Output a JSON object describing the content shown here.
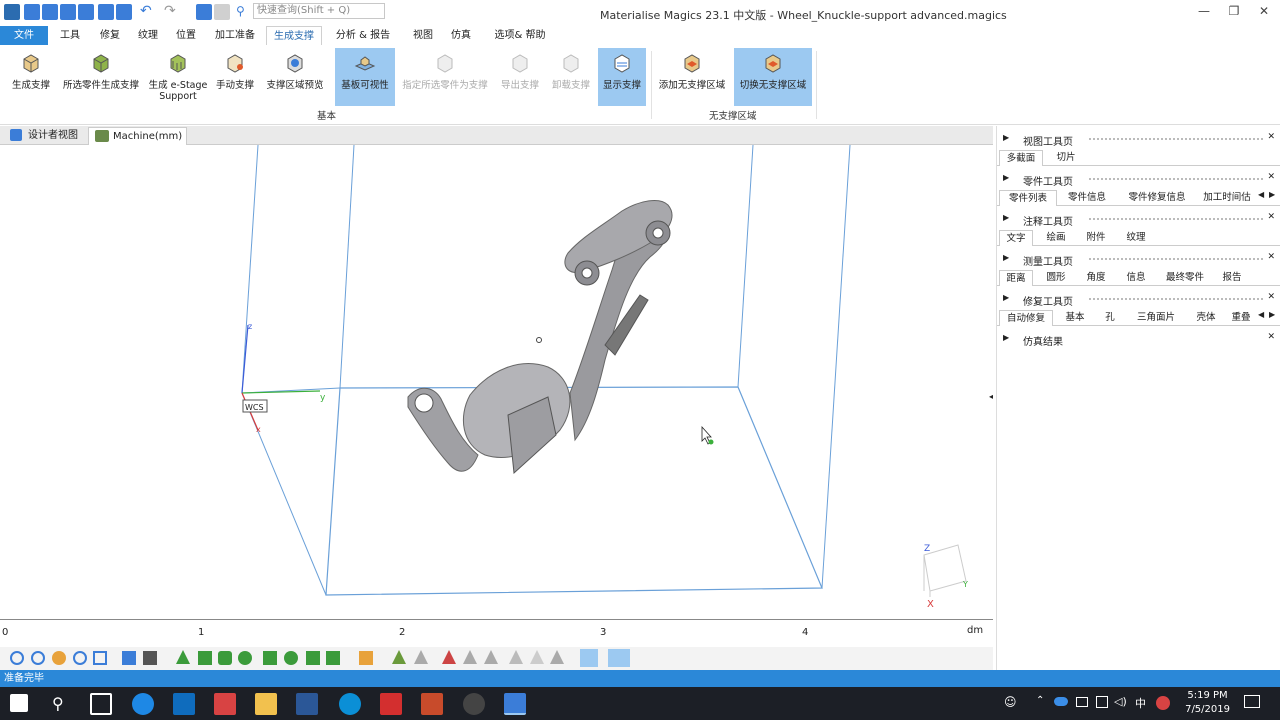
{
  "app": {
    "title": "Materialise Magics 23.1 中文版 - Wheel_Knuckle-support advanced.magics",
    "search_placeholder": "快速查询(Shift + Q)",
    "accent": "#2b88d8"
  },
  "menu": [
    "文件",
    "工具",
    "修复",
    "纹理",
    "位置",
    "加工准备",
    "生成支撑",
    "分析 & 报告",
    "视图",
    "仿真",
    "选项& 帮助"
  ],
  "ribbon": {
    "buttons": [
      {
        "label": "生成支撑"
      },
      {
        "label": "所选零件生成支撑"
      },
      {
        "label": "生成 e-Stage Support"
      },
      {
        "label": "手动支撑"
      },
      {
        "label": "支撑区域预览"
      },
      {
        "label": "基板可视性"
      },
      {
        "label": "指定所选零件为支撑"
      },
      {
        "label": "导出支撑"
      },
      {
        "label": "卸载支撑"
      },
      {
        "label": "显示支撑"
      },
      {
        "label": "添加无支撑区域"
      },
      {
        "label": "切换无支撑区域"
      }
    ],
    "groups": [
      "基本",
      "无支撑区域"
    ]
  },
  "doc_tabs": [
    "设计者视图",
    "Machine(mm)"
  ],
  "viewport": {
    "axis_labels": {
      "z": "z",
      "y": "y",
      "x": "x"
    },
    "wcs": "WCS",
    "triad": {
      "z": "Z",
      "y": "Y",
      "x": "X"
    }
  },
  "ruler": {
    "ticks": [
      "0",
      "1",
      "2",
      "3",
      "4"
    ],
    "unit": "dm"
  },
  "panels": [
    {
      "title": "视图工具页",
      "tabs": [
        "多截面",
        "切片"
      ]
    },
    {
      "title": "零件工具页",
      "tabs": [
        "零件列表",
        "零件信息",
        "零件修复信息",
        "加工时间估"
      ]
    },
    {
      "title": "注释工具页",
      "tabs": [
        "文字",
        "绘画",
        "附件",
        "纹理"
      ]
    },
    {
      "title": "测量工具页",
      "tabs": [
        "距离",
        "圆形",
        "角度",
        "信息",
        "最终零件",
        "报告"
      ]
    },
    {
      "title": "修复工具页",
      "tabs": [
        "自动修复",
        "基本",
        "孔",
        "三角面片",
        "壳体",
        "重叠"
      ]
    },
    {
      "title": "仿真结果",
      "tabs": []
    }
  ],
  "status": "准备完毕",
  "taskbar": {
    "time": "5:19 PM",
    "date": "7/5/2019",
    "ime": "中"
  }
}
